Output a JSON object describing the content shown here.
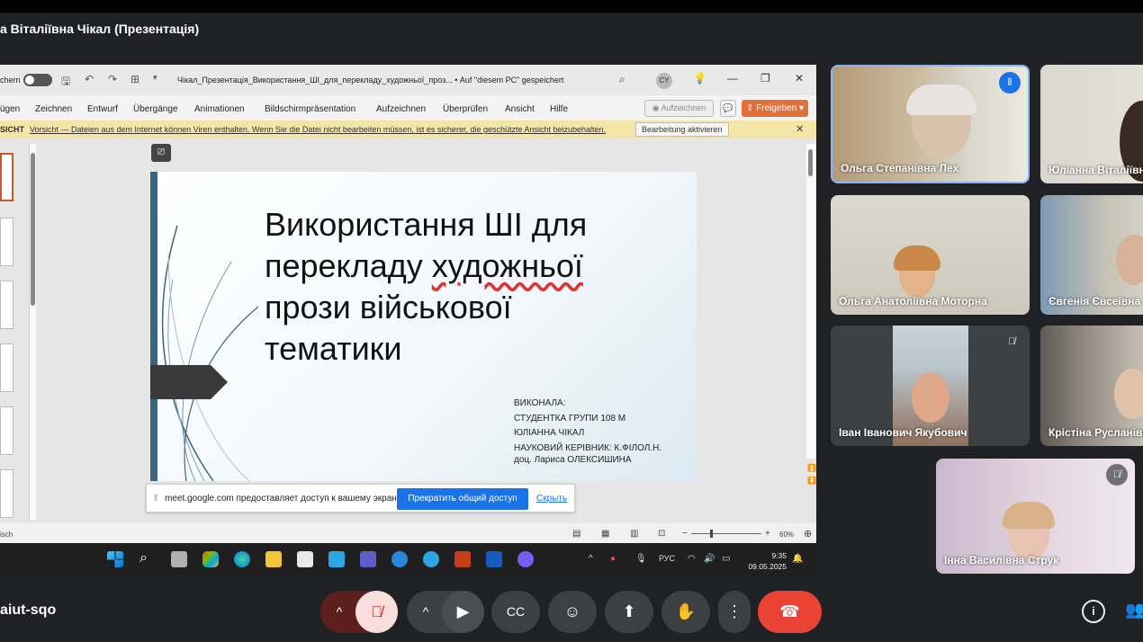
{
  "meet": {
    "presenter_title": "а Віталіївна Чікал (Презентація)",
    "meeting_code": "aiut-sqo"
  },
  "powerpoint": {
    "autosave_label": "chern",
    "filename": "Чікал_Презентація_Використання_ШІ_для_перекладу_художньої_проз...  •  Auf \"diesem PC\" gespeichert",
    "user_initials": "CY",
    "ribbon_tabs": [
      "ügen",
      "Zeichnen",
      "Entwurf",
      "Übergänge",
      "Animationen",
      "Bildschirmpräsentation",
      "Aufzeichnen",
      "Überprüfen",
      "Ansicht",
      "Hilfe"
    ],
    "record_button": "Aufzeichnen",
    "share_button": "Freigeben",
    "warning_label": "SICHT",
    "warning_text": "Vorsicht — Dateien aus dem Internet können Viren enthalten. Wenn Sie die Datei nicht bearbeiten müssen, ist es sicherer, die geschützte Ansicht beizubehalten.",
    "enable_editing": "Bearbeitung aktivieren",
    "status_language": "isch",
    "zoom": "60%"
  },
  "slide": {
    "title_line1": "Використання ШІ для",
    "title_line2_a": "перекладу ",
    "title_line2_b": "художньої",
    "title_line3": "прози військової",
    "title_line4": "тематики",
    "credits": [
      "ВИКОНАЛА:",
      "СТУДЕНТКА ГРУПИ 108 М",
      "ЮЛІАННА ЧІКАЛ",
      "НАУКОВИЙ КЕРІВНИК: К.ФІЛОЛ.Н.",
      "доц. Лариса ОЛЕКСИШИНА"
    ]
  },
  "share_notice": {
    "message": "meet.google.com предоставляет доступ к вашему экрану.",
    "stop_button": "Прекратить общий доступ",
    "hide_link": "Скрыть"
  },
  "taskbar": {
    "language": "РУС",
    "time": "9:35",
    "date": "09.05.2025"
  },
  "participants": [
    {
      "name": "Ольга Степанівна Лех"
    },
    {
      "name": "Юліанна Віталіївна"
    },
    {
      "name": "Ольга Анатоліївна Моторна"
    },
    {
      "name": "Євгенія Євсеївна"
    },
    {
      "name": "Іван Іванович Якубович"
    },
    {
      "name": "Крістіна Русланівна"
    },
    {
      "name": "Інна Василівна Струк"
    }
  ],
  "colors": {
    "meet_bg": "#202124",
    "end_call": "#ea4335",
    "mic_off": "#f9dedc",
    "share_accent": "#e2703a",
    "stop_share": "#1a73e8"
  }
}
